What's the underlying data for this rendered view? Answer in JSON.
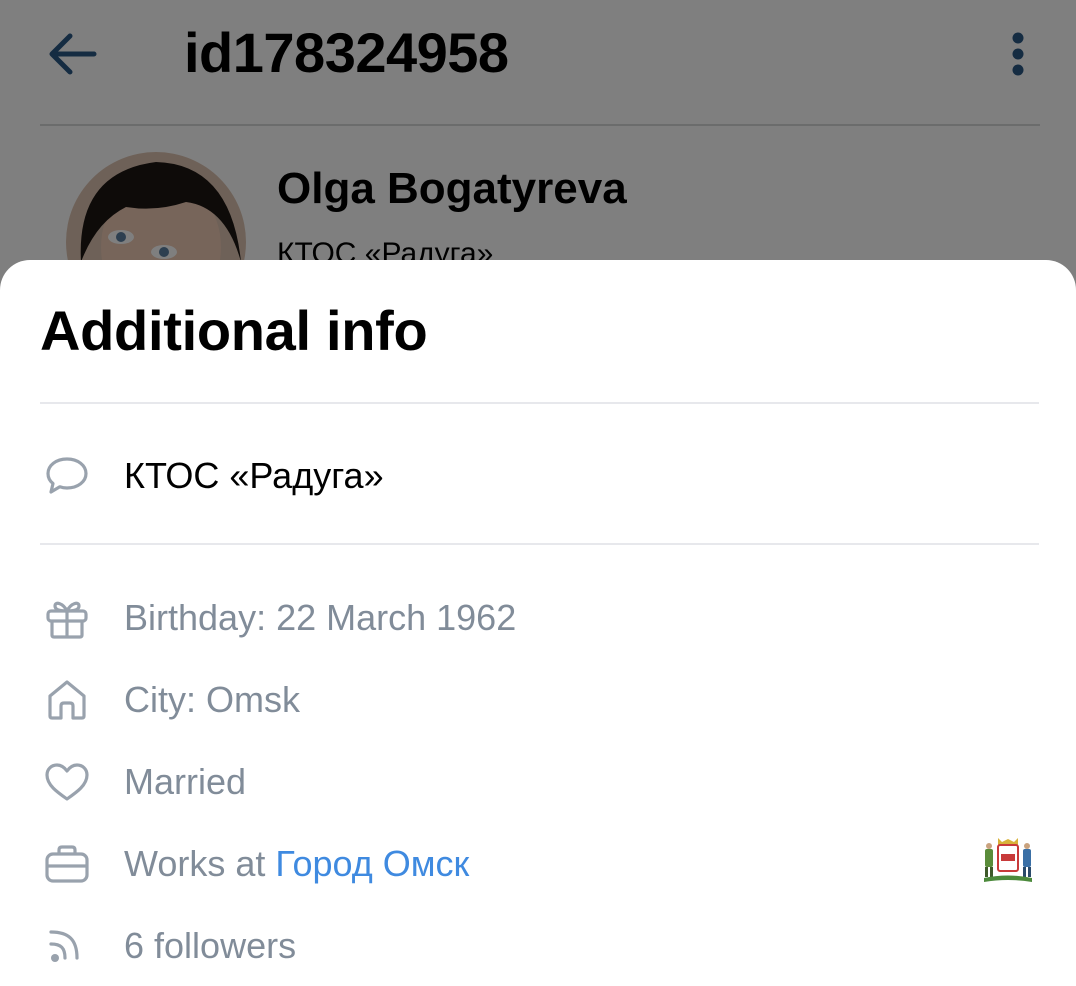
{
  "header": {
    "title": "id178324958",
    "back_icon": "arrow-left-icon",
    "menu_icon": "more-vertical-icon"
  },
  "profile": {
    "name": "Olga Bogatyreva",
    "status": "КТОС «Радуга»"
  },
  "sheet": {
    "title": "Additional info",
    "status_row": {
      "icon": "message-bubble-icon",
      "text": "КТОС «Радуга»"
    },
    "details": [
      {
        "icon": "gift-icon",
        "text": "Birthday: 22 March 1962"
      },
      {
        "icon": "home-icon",
        "text": "City: Omsk"
      },
      {
        "icon": "heart-icon",
        "text": "Married"
      },
      {
        "icon": "briefcase-icon",
        "prefix": "Works at ",
        "link": "Город Омск"
      },
      {
        "icon": "rss-icon",
        "text": "6 followers"
      }
    ]
  },
  "colors": {
    "link": "#3f8ae0",
    "secondary_text": "#818c99",
    "icon": "#99a2ad",
    "accent": "#2a5885",
    "overlay": "rgba(0,0,0,0.5)"
  }
}
